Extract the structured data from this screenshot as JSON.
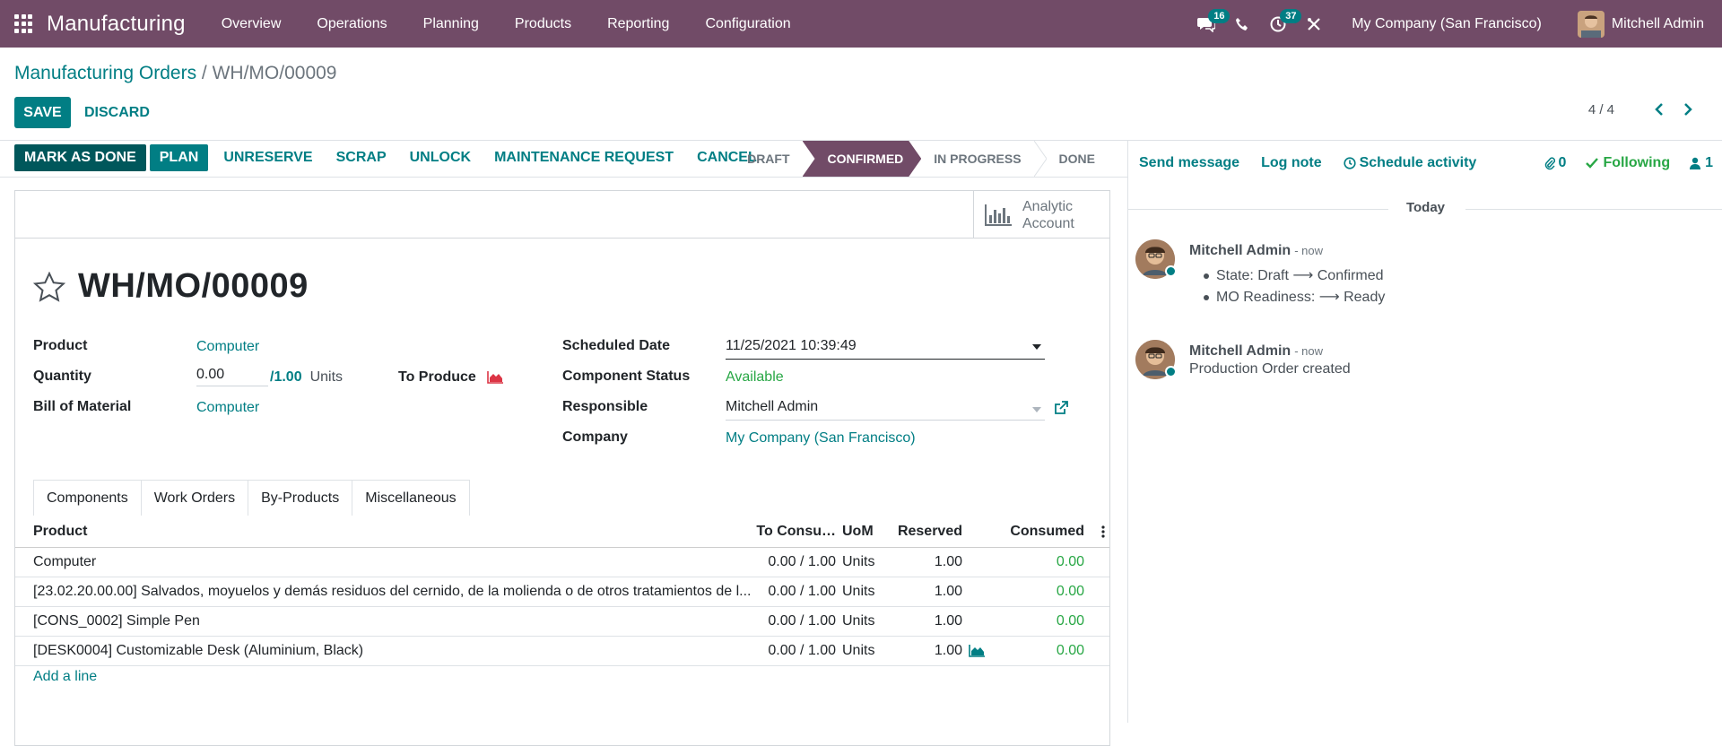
{
  "navbar": {
    "brand": "Manufacturing",
    "menu": [
      "Overview",
      "Operations",
      "Planning",
      "Products",
      "Reporting",
      "Configuration"
    ],
    "messages_badge": "16",
    "activities_badge": "37",
    "company": "My Company (San Francisco)",
    "user": "Mitchell Admin",
    "accent_color": "#714b67"
  },
  "breadcrumb": {
    "parent": "Manufacturing Orders",
    "separator": " / ",
    "current": "WH/MO/00009"
  },
  "control": {
    "save_label": "SAVE",
    "discard_label": "DISCARD",
    "pager_value": "4 / 4"
  },
  "statusbar": {
    "buttons": [
      "MARK AS DONE",
      "PLAN",
      "UNRESERVE",
      "SCRAP",
      "UNLOCK",
      "MAINTENANCE REQUEST",
      "CANCEL"
    ],
    "stages": [
      "DRAFT",
      "CONFIRMED",
      "IN PROGRESS",
      "DONE"
    ],
    "active_stage": "CONFIRMED"
  },
  "smart_button": {
    "label_line1": "Analytic",
    "label_line2": "Account"
  },
  "record": {
    "title": "WH/MO/00009",
    "product_label": "Product",
    "product_value": "Computer",
    "quantity_label": "Quantity",
    "quantity_value": "0.00",
    "quantity_total": "/1.00",
    "quantity_uom": "Units",
    "to_produce_label": "To Produce",
    "bom_label": "Bill of Material",
    "bom_value": "Computer",
    "scheduled_label": "Scheduled Date",
    "scheduled_value": "11/25/2021 10:39:49",
    "component_status_label": "Component Status",
    "component_status_value": "Available",
    "responsible_label": "Responsible",
    "responsible_value": "Mitchell Admin",
    "company_label": "Company",
    "company_value": "My Company (San Francisco)"
  },
  "tabs": [
    "Components",
    "Work Orders",
    "By-Products",
    "Miscellaneous"
  ],
  "table": {
    "headers": {
      "product": "Product",
      "to_consume": "To Consu…",
      "uom": "UoM",
      "reserved": "Reserved",
      "consumed": "Consumed"
    },
    "rows": [
      {
        "product": "Computer",
        "to_consume": "0.00 / 1.00",
        "uom": "Units",
        "reserved": "1.00",
        "consumed": "0.00"
      },
      {
        "product": "[23.02.20.00.00] Salvados, moyuelos y demás residuos del cernido, de la molienda o de otros tratamientos de l...",
        "to_consume": "0.00 / 1.00",
        "uom": "Units",
        "reserved": "1.00",
        "consumed": "0.00"
      },
      {
        "product": "[CONS_0002] Simple Pen",
        "to_consume": "0.00 / 1.00",
        "uom": "Units",
        "reserved": "1.00",
        "consumed": "0.00"
      },
      {
        "product": "[DESK0004] Customizable Desk (Aluminium, Black)",
        "to_consume": "0.00 / 1.00",
        "uom": "Units",
        "reserved": "1.00",
        "consumed": "0.00"
      }
    ],
    "add_line": "Add a line"
  },
  "chatter": {
    "send_message": "Send message",
    "log_note": "Log note",
    "schedule_activity": "Schedule activity",
    "attachments_count": "0",
    "following": "Following",
    "followers_count": "1",
    "date_separator": "Today",
    "messages": [
      {
        "author": "Mitchell Admin",
        "time": "- now",
        "changes": [
          "State: Draft ⟶ Confirmed",
          "MO Readiness: ⟶ Ready"
        ]
      },
      {
        "author": "Mitchell Admin",
        "time": "- now",
        "body": "Production Order created"
      }
    ]
  }
}
